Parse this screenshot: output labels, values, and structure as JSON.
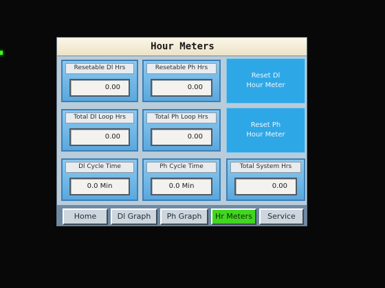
{
  "screen": {
    "title": "Hour Meters"
  },
  "panels": {
    "resetable_dl_hrs": {
      "label": "Resetable Dl Hrs",
      "value": "0.00"
    },
    "resetable_ph_hrs": {
      "label": "Resetable Ph Hrs",
      "value": "0.00"
    },
    "total_dl_loop_hrs": {
      "label": "Total Dl Loop Hrs",
      "value": "0.00"
    },
    "total_ph_loop_hrs": {
      "label": "Total Ph Loop Hrs",
      "value": "0.00"
    },
    "dl_cycle_time": {
      "label": "Dl Cycle Time",
      "value": "0.0 Min"
    },
    "ph_cycle_time": {
      "label": "Ph Cycle Time",
      "value": "0.0 Min"
    },
    "total_system_hrs": {
      "label": "Total System Hrs",
      "value": "0.00"
    }
  },
  "buttons": {
    "reset_dl": {
      "line1": "Reset Dl",
      "line2": "Hour Meter"
    },
    "reset_ph": {
      "line1": "Reset Ph",
      "line2": "Hour Meter"
    }
  },
  "nav": {
    "home": "Home",
    "dl_graph": "Dl Graph",
    "ph_graph": "Ph Graph",
    "hr_meters": "Hr Meters",
    "service": "Service",
    "active": "hr_meters"
  },
  "colors": {
    "active_tab": "#41d61f",
    "reset_button": "#2ea7e6",
    "panel": "#6fb6e6",
    "status_led": "#39ff14"
  }
}
